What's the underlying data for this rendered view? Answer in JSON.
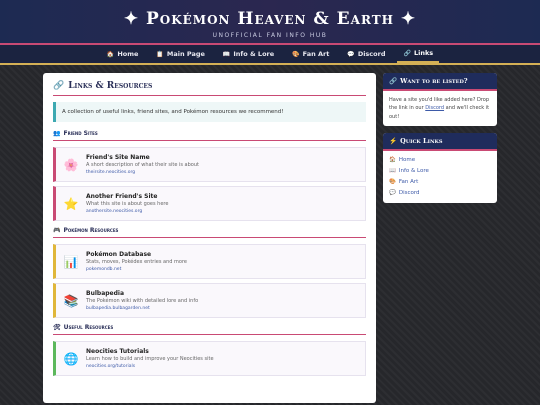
{
  "site": {
    "title": "✦ Pokémon Heaven & Earth ✦",
    "subtitle": "UNOFFICIAL FAN INFO HUB"
  },
  "nav": [
    {
      "icon": "🏠",
      "label": "Home",
      "active": false
    },
    {
      "icon": "📋",
      "label": "Main Page",
      "active": false
    },
    {
      "icon": "📖",
      "label": "Info & Lore",
      "active": false
    },
    {
      "icon": "🎨",
      "label": "Fan Art",
      "active": false
    },
    {
      "icon": "💬",
      "label": "Discord",
      "active": false
    },
    {
      "icon": "🔗",
      "label": "Links",
      "active": true
    }
  ],
  "main": {
    "title": "Links & Resources",
    "title_icon": "🔗",
    "intro": "A collection of useful links, friend sites, and Pokémon resources we recommend!",
    "sections": [
      {
        "title": "Friend Sites",
        "icon": "👥",
        "cards": [
          {
            "icon": "🌸",
            "name": "Friend's Site Name",
            "desc": "A short description of what their site is about",
            "url": "theirsite.neocities.org"
          },
          {
            "icon": "⭐",
            "name": "Another Friend's Site",
            "desc": "What this site is about goes here",
            "url": "anothersite.neocities.org"
          }
        ]
      },
      {
        "title": "Pokémon Resources",
        "icon": "🎮",
        "cards": [
          {
            "icon": "📊",
            "name": "Pokémon Database",
            "desc": "Stats, moves, Pokédex entries and more",
            "url": "pokemondb.net"
          },
          {
            "icon": "📚",
            "name": "Bulbapedia",
            "desc": "The Pokémon wiki with detailed lore and info",
            "url": "bulbapedia.bulbagarden.net"
          }
        ]
      },
      {
        "title": "Useful Resources",
        "icon": "🛠",
        "cards": [
          {
            "icon": "🌐",
            "name": "Neocities Tutorials",
            "desc": "Learn how to build and improve your Neocities site",
            "url": "neocities.org/tutorials"
          }
        ]
      }
    ]
  },
  "sidebar": {
    "listed": {
      "icon": "🔗",
      "title": "Want to be listed?",
      "text_before": "Have a site you'd like added here? Drop the link in our ",
      "link": "Discord",
      "text_after": " and we'll check it out!"
    },
    "quick_links": {
      "icon": "⚡",
      "title": "Quick Links",
      "items": [
        {
          "icon": "🏠",
          "label": "Home"
        },
        {
          "icon": "📖",
          "label": "Info & Lore"
        },
        {
          "icon": "🎨",
          "label": "Fan Art"
        },
        {
          "icon": "💬",
          "label": "Discord"
        }
      ]
    }
  }
}
